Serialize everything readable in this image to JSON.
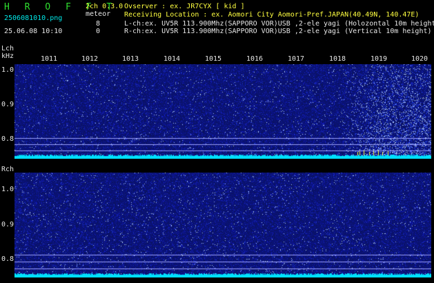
{
  "header": {
    "app_title": "H R O F F T",
    "filename": "2506081010.png",
    "datetime": "25.06.08 10:10",
    "mode": "2ch 0.3.0",
    "meteor_label": "meteor",
    "meteor_lch": "8",
    "meteor_rch": "0",
    "observer": "Ovserver           : ex. JR7CYX [ kid ]",
    "location": "Receiving Location : ex. Aomori City Aomori-Pref.JAPAN(40.49N, 140.47E)",
    "lch_info": "L-ch:ex. UV5R 113.900Mhz(SAPPORO VOR)USB ,2-ele yagi (Holozontal 10m height)",
    "rch_info": "R-ch:ex. UV5R 113.900Mhz(SAPPORO VOR)USB ,2-ele yagi (Vertical 10m height)"
  },
  "lch": {
    "channel_label": "Lch",
    "unit_label": "kHz",
    "minute_ticks": [
      "1011",
      "1012",
      "1013",
      "1014",
      "1015",
      "1016",
      "1017",
      "1018",
      "1019",
      "1020"
    ],
    "freq_labels": [
      "1.0",
      "0.9",
      "0.8"
    ]
  },
  "rch": {
    "channel_label": "Rch",
    "freq_labels": [
      "1.0",
      "0.9",
      "0.8"
    ]
  },
  "colors": {
    "background": "#000000",
    "waterfall_base": "#101c70",
    "baseline": "#00e0ff",
    "label_text": "#e8e8e8",
    "header_text": "#00e8e8",
    "title_text": "#30e030"
  }
}
